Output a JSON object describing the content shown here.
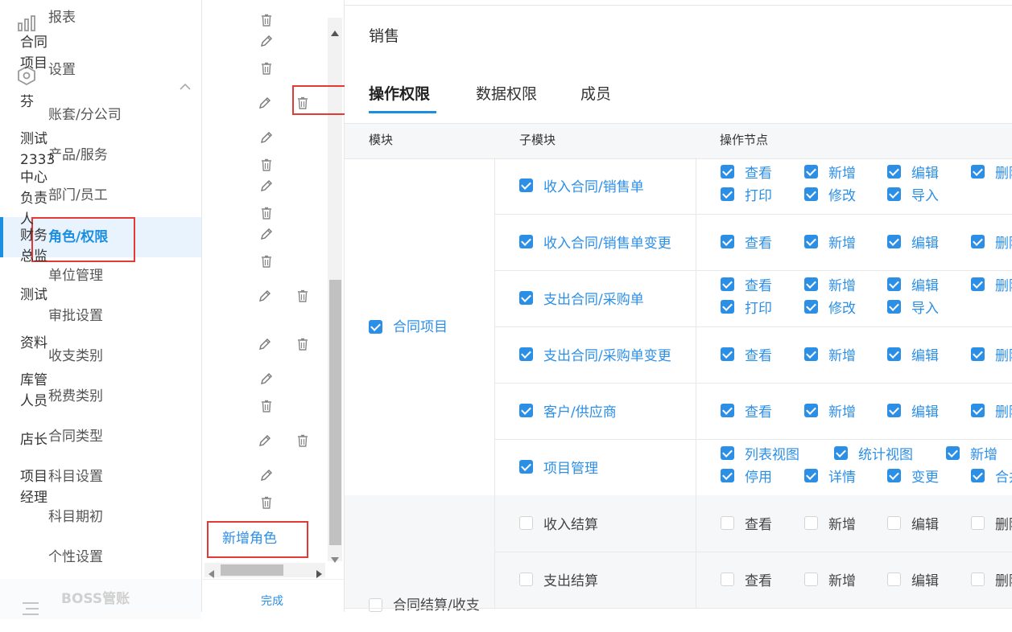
{
  "sidebar": {
    "top_item": {
      "label": "报表",
      "icon": "bar-chart-icon"
    },
    "settings": {
      "label": "设置",
      "icon": "hexagon-gear-icon"
    },
    "items": [
      {
        "label": "账套/分公司"
      },
      {
        "label": "产品/服务"
      },
      {
        "label": "部门/员工"
      },
      {
        "label": "角色/权限"
      },
      {
        "label": "单位管理"
      },
      {
        "label": "审批设置"
      },
      {
        "label": "收支类别"
      },
      {
        "label": "税费类别"
      },
      {
        "label": "合同类型"
      },
      {
        "label": "科目设置"
      },
      {
        "label": "科目期初"
      },
      {
        "label": "个性设置"
      }
    ],
    "bottom_item": {
      "label": "BOSS管账"
    },
    "active_color": "#1a8ee1"
  },
  "roles": {
    "items": [
      {
        "lines": [
          "合同",
          "项目"
        ]
      },
      {
        "lines": [
          "芬"
        ]
      },
      {
        "lines": [
          "测试",
          "2333",
          "中心",
          "负责",
          "人"
        ]
      },
      {
        "lines": [
          "财务",
          "总监"
        ]
      },
      {
        "lines": [
          "测试"
        ]
      },
      {
        "lines": [
          "资料"
        ]
      },
      {
        "lines": [
          "库管",
          "人员"
        ]
      },
      {
        "lines": [
          "店长"
        ]
      },
      {
        "lines": [
          "项目",
          "经理"
        ]
      }
    ],
    "add_role": "新增角色",
    "done": "完成"
  },
  "main": {
    "title": "销售",
    "tabs": [
      "操作权限",
      "数据权限",
      "成员"
    ],
    "headers": {
      "module": "模块",
      "submodule": "子模块",
      "ops": "操作节点"
    },
    "groups": [
      {
        "module": "合同项目",
        "checked": true,
        "rows": [
          {
            "name": "收入合同/销售单",
            "checked": true,
            "ops": [
              [
                "查看",
                "新增",
                "编辑",
                "删除"
              ],
              [
                "打印",
                "修改",
                "导入"
              ]
            ]
          },
          {
            "name": "收入合同/销售单变更",
            "checked": true,
            "ops": [
              [
                "查看",
                "新增",
                "编辑",
                "删除"
              ]
            ]
          },
          {
            "name": "支出合同/采购单",
            "checked": true,
            "ops": [
              [
                "查看",
                "新增",
                "编辑",
                "删除"
              ],
              [
                "打印",
                "修改",
                "导入"
              ]
            ]
          },
          {
            "name": "支出合同/采购单变更",
            "checked": true,
            "ops": [
              [
                "查看",
                "新增",
                "编辑",
                "删除"
              ]
            ]
          },
          {
            "name": "客户/供应商",
            "checked": true,
            "ops": [
              [
                "查看",
                "新增",
                "编辑",
                "删除"
              ]
            ]
          },
          {
            "name": "项目管理",
            "checked": true,
            "ops": [
              [
                "列表视图",
                "统计视图",
                "新增"
              ],
              [
                "停用",
                "详情",
                "变更",
                "合并"
              ]
            ]
          }
        ]
      },
      {
        "module": "合同结算/收支",
        "checked": false,
        "rows": [
          {
            "name": "收入结算",
            "checked": false,
            "ops": [
              [
                "查看",
                "新增",
                "编辑",
                "删除"
              ]
            ]
          },
          {
            "name": "支出结算",
            "checked": false,
            "ops": [
              [
                "查看",
                "新增",
                "编辑",
                "删除"
              ]
            ]
          }
        ]
      }
    ]
  }
}
